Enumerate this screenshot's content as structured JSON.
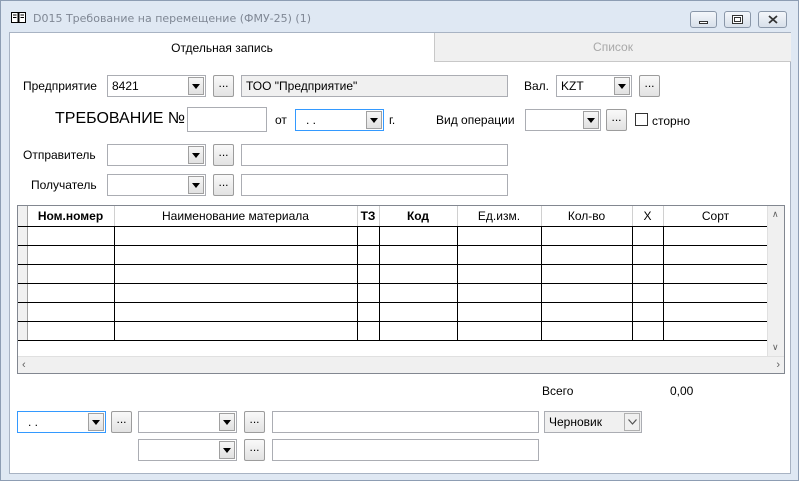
{
  "window": {
    "title": "D015 Требование на перемещение (ФМУ-25) (1)"
  },
  "tabs": [
    {
      "label": "Отдельная запись",
      "active": true
    },
    {
      "label": "Список",
      "active": false
    }
  ],
  "header": {
    "enterprise_label": "Предприятие",
    "enterprise_code": "8421",
    "enterprise_name": "ТОО \"Предприятие\"",
    "currency_label": "Вал.",
    "currency_value": "KZT",
    "doc_title": "ТРЕБОВАНИЕ №",
    "doc_number": "",
    "from_label": "от",
    "date_value": ". .",
    "year_suffix": "г.",
    "operation_label": "Вид операции",
    "operation_value": "",
    "storno_label": "сторно",
    "storno_checked": false,
    "sender_label": "Отправитель",
    "sender_value": "",
    "sender_name": "",
    "receiver_label": "Получатель",
    "receiver_value": "",
    "receiver_name": ""
  },
  "grid": {
    "columns": [
      "Ном.номер",
      "Наименование материала",
      "ТЗ",
      "Код",
      "Ед.изм.",
      "Кол-во",
      "Х",
      "Сорт"
    ],
    "row_count": 6
  },
  "totals": {
    "label": "Всего",
    "value": "0,00"
  },
  "footer": {
    "date_value": ". .",
    "combo2_value": "",
    "combo3_value": "",
    "status_value": "Черновик",
    "ellipsis": "..."
  },
  "ellipsis_label": "..."
}
